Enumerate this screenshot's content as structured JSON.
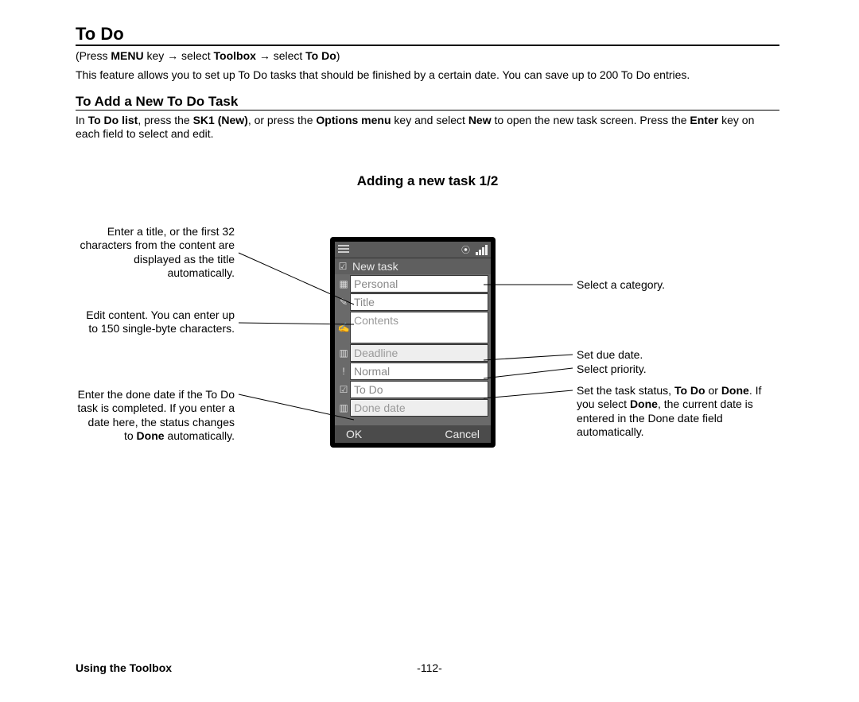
{
  "heading": "To Do",
  "nav": {
    "prefix": "(Press ",
    "menu_key": "MENU",
    "mid1": " key ",
    "arrow": "→",
    "mid2": " select ",
    "toolbox": "Toolbox",
    "mid3": " select ",
    "todo": "To Do",
    "suffix": ")"
  },
  "intro": "This feature allows you to set up To Do tasks that should be finished by a certain date. You can save up to 200 To Do entries.",
  "sub_heading": "To Add a New To Do Task",
  "sub_body_parts": {
    "p0": "In ",
    "b0": "To Do list",
    "p1": ", press the ",
    "b1": "SK1 (New)",
    "p2": ", or press the ",
    "b2": "Options menu",
    "p3": " key and select ",
    "b3": "New",
    "p4": " to open the new task screen. Press the ",
    "b4": "Enter",
    "p5": " key on each field to select and edit."
  },
  "diagram_title": "Adding a new task 1/2",
  "phone": {
    "screen_title": "New task",
    "fields": {
      "category": "Personal",
      "title": "Title",
      "contents": "Contents",
      "deadline": "Deadline",
      "priority": "Normal",
      "status": "To Do",
      "done_date": "Done date"
    },
    "softkeys": {
      "left": "OK",
      "right": "Cancel"
    }
  },
  "annotations": {
    "left1": "Enter a title, or the first 32 characters from the content are displayed as the title automatically.",
    "left2": "Edit content. You can enter up to 150 single-byte characters.",
    "left3_pre": "Enter the done date if the To Do task is completed. If you enter a date here, the status changes to ",
    "left3_bold": "Done",
    "left3_post": " automatically.",
    "right1": "Select a category.",
    "right2": "Set due date.",
    "right3": "Select priority.",
    "right4_pre": "Set the task status, ",
    "right4_b1": "To Do",
    "right4_mid": " or ",
    "right4_b2": "Done",
    "right4_mid2": ". If you select ",
    "right4_b3": "Done",
    "right4_post": ", the current date is entered in the Done date field automatically."
  },
  "footer": {
    "section": "Using the Toolbox",
    "page": "-112-"
  }
}
